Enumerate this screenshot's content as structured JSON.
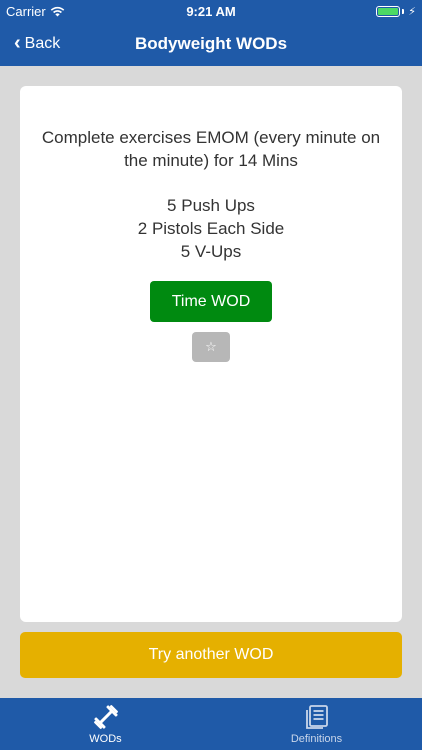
{
  "status_bar": {
    "carrier": "Carrier",
    "time": "9:21 AM"
  },
  "nav": {
    "back_label": "Back",
    "title": "Bodyweight WODs"
  },
  "card": {
    "description": "Complete exercises EMOM (every minute on the minute) for 14 Mins",
    "exercises": [
      "5 Push Ups",
      "2 Pistols Each Side",
      "5 V-Ups"
    ],
    "time_wod_label": "Time WOD",
    "favorite_icon": "star-outline-icon",
    "favorite_glyph": "☆"
  },
  "try_another_label": "Try another WOD",
  "tabs": [
    {
      "label": "WODs",
      "icon": "dumbbell-icon",
      "active": true
    },
    {
      "label": "Definitions",
      "icon": "document-list-icon",
      "active": false
    }
  ],
  "colors": {
    "brand_blue": "#1f5aa8",
    "time_wod_green": "#008a10",
    "try_another_yellow": "#e5b000",
    "battery_green": "#4cd964"
  }
}
